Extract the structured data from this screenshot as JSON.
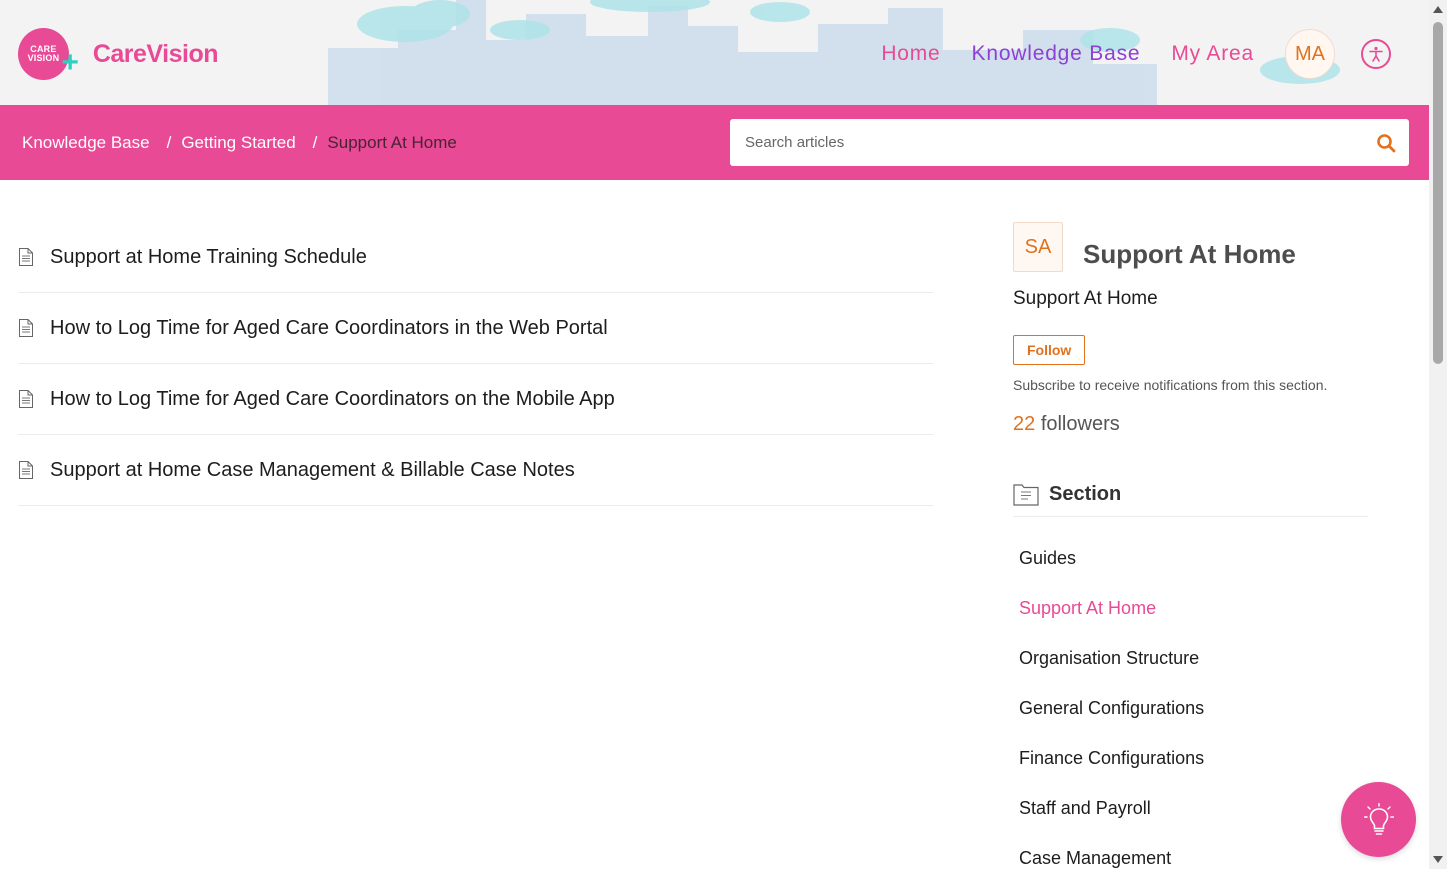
{
  "brand": {
    "name": "CareVision",
    "badge_text": "CARE VISION"
  },
  "nav": {
    "home": "Home",
    "knowledge_base": "Knowledge Base",
    "my_area": "My Area",
    "avatar_initials": "MA"
  },
  "breadcrumb": [
    "Knowledge Base",
    "Getting Started",
    "Support At Home"
  ],
  "search": {
    "placeholder": "Search articles"
  },
  "articles": [
    "Support at Home Training Schedule",
    "How to Log Time for Aged Care Coordinators in the Web Portal",
    "How to Log Time for Aged Care Coordinators on the Mobile App",
    "Support at Home Case Management & Billable Case Notes"
  ],
  "sidebar": {
    "initials": "SA",
    "title": "Support At Home",
    "description": "Support At Home",
    "follow_label": "Follow",
    "subscribe_note": "Subscribe to receive notifications from this section.",
    "followers_count": "22",
    "followers_label": "followers",
    "section_label": "Section",
    "sections": [
      "Guides",
      "Support At Home",
      "Organisation Structure",
      "General Configurations",
      "Finance Configurations",
      "Staff and Payroll",
      "Case Management"
    ],
    "active_section": "Support At Home"
  },
  "colors": {
    "brand_pink": "#e84a95",
    "accent_orange": "#e0721f",
    "nav_active_purple": "#8e3fd6"
  },
  "icons": {
    "search": "search-icon",
    "accessibility": "accessibility-icon",
    "help": "lightbulb-icon",
    "article": "document-icon",
    "section": "section-icon"
  }
}
